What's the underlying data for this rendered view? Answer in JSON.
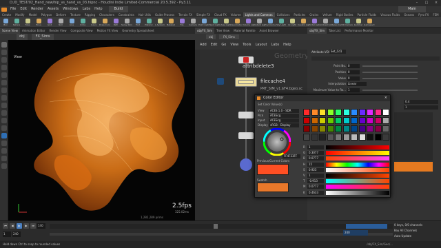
{
  "window": {
    "title": "D:/D_TEST/02_Hand_new/hip_vs_hand_vs_03.hipnc - Houdini Indie Limited-Commercial 20.5.392 - Py3.11",
    "desktop": "Main",
    "build": "Build"
  },
  "menu": [
    "File",
    "Edit",
    "Render",
    "Assets",
    "Windows",
    "Labs",
    "Help"
  ],
  "shelf": {
    "tabs": [
      "Create",
      "Modify",
      "Model",
      "Polygon",
      "Deform",
      "Texture",
      "Rigging",
      "Characters",
      "Constraints",
      "Hair Utils",
      "Guide Process",
      "Terrain FX",
      "Simple FX",
      "Cloud FX",
      "Volume",
      "Lights and Cameras",
      "Collisions",
      "Particles",
      "Grains",
      "Vellum",
      "Rigid Bodies",
      "Particle Fluids",
      "Viscous Fluids",
      "Oceans",
      "Pyro FX",
      "FEM",
      "Wires",
      "Crowds",
      "Drive Simulation"
    ],
    "tools": [
      "Box",
      "Sphere",
      "Tube",
      "Torus",
      "Grid",
      "Null",
      "Line",
      "Circle",
      "Curve",
      "Draw Curve",
      "Path",
      "Spray Paint",
      "Font",
      "Platonic",
      "L-System",
      "Metaball",
      "File",
      "Camera",
      "Point Light",
      "Spot Light",
      "Area Light",
      "Geometry Light",
      "Volume Light",
      "Distant Light",
      "Environment Light",
      "Sky Light",
      "GI Light",
      "Caustic Light",
      "Portal Light",
      "Ambient Light",
      "Stereo Camera",
      "VR Camera",
      "Switcher",
      "Gamepad Camera"
    ]
  },
  "viewport": {
    "tabs": [
      "Scene View",
      "Animation Editor",
      "Render View",
      "Composite View",
      "Motion FX View",
      "Geometry Spreadsheet"
    ],
    "path": [
      "obj",
      "FX_Sims"
    ],
    "label": "View",
    "fps": "2.5fps",
    "fps_sub": "325.02ms",
    "resolution": "1,282,289 prims"
  },
  "network": {
    "tabs": [
      "obj/FX_Sim",
      "Tree View",
      "Material Palette",
      "Asset Browser"
    ],
    "path": [
      "obj",
      "FX_Sims"
    ],
    "menu": [
      "Add",
      "Edit",
      "Go",
      "View",
      "Tools",
      "Layout",
      "Labs",
      "Help"
    ],
    "context_label": "Geometry",
    "nodes": {
      "attribdelete": "attribdelete3",
      "filecache": "filecache4",
      "filecache_sub": "PRT_SIM_v1.$F4.bgeo.sc"
    }
  },
  "params": {
    "tabs": [
      "obj/FX_Sim",
      "Take List",
      "Performance Monitor"
    ],
    "node_type": "Attribute VOP",
    "node_name": "Set_Cd1",
    "rows": [
      {
        "label": "Point No.",
        "value": "0"
      },
      {
        "label": "Position",
        "value": "0"
      },
      {
        "label": "Value",
        "value": "0"
      },
      {
        "label": "Interpolation",
        "value": "Linear"
      },
      {
        "label": "Maximum Value to Ro...",
        "value": "1"
      }
    ],
    "side_values": [
      "0.4",
      "1",
      "0",
      "0"
    ]
  },
  "color_editor": {
    "title": "Color Editor",
    "subtitle": "Set Color Value(s)",
    "fields": [
      {
        "label": "View",
        "value": "ACES 1.0 - SDR Video"
      },
      {
        "label": "Pick",
        "value": "ACEScg"
      },
      {
        "label": "Input",
        "value": "ACEScg"
      },
      {
        "label": "Display",
        "value": "sRGB - Display"
      }
    ],
    "hex": "FF4F23FF",
    "prev_current": "Previous/Current Colors",
    "swatch_label": "Swatch",
    "channels": [
      {
        "label": "R",
        "value": "1"
      },
      {
        "label": "G",
        "value": "0.3077"
      },
      {
        "label": "B",
        "value": "0.0777"
      },
      {
        "label": "H",
        "value": "15"
      },
      {
        "label": "S",
        "value": "0.923"
      },
      {
        "label": "V",
        "value": "1"
      },
      {
        "label": "T",
        "value": "-0.913"
      },
      {
        "label": "M",
        "value": "0.0777"
      },
      {
        "label": "K",
        "value": "0.4633"
      }
    ],
    "extra_values": [
      "0.0777",
      "0.0777"
    ]
  },
  "timeline": {
    "frame_start": "1",
    "frame_end": "240",
    "current_frame": "140",
    "range_end": "240",
    "ticks": [
      "1",
      "24",
      "48",
      "72",
      "96",
      "120",
      "144",
      "168",
      "192",
      "216",
      "240"
    ],
    "keys_label": "0 keys, 0/0 channels",
    "key_all": "Key All Channels",
    "status": "Auto Update",
    "path": "/obj/FX_Sim/Geo/..."
  },
  "statusbar": {
    "message": "Hold down Ctrl to snap to rounded values"
  },
  "colors": {
    "accent": "#f07c22",
    "orange_swatch": "#ff4f23",
    "node_yellow": "#f5e6a0"
  }
}
